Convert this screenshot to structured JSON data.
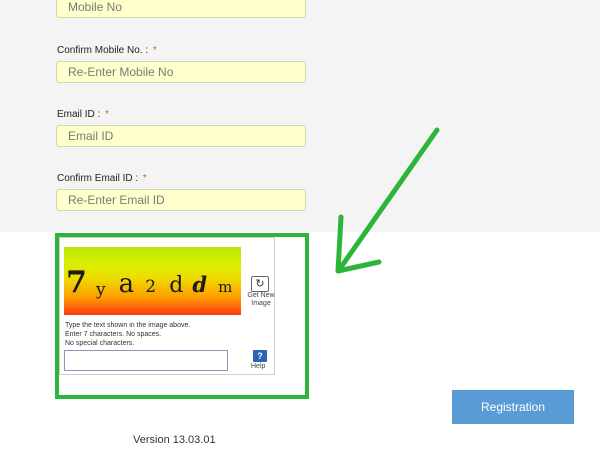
{
  "form": {
    "mobile_placeholder": "Mobile No",
    "confirm_mobile_label": "Confirm Mobile No. :",
    "confirm_mobile_placeholder": "Re-Enter Mobile No",
    "email_label": "Email ID :",
    "email_placeholder": "Email ID",
    "confirm_email_label": "Confirm Email ID :",
    "confirm_email_placeholder": "Re-Enter Email ID",
    "required_marker": "*"
  },
  "captcha": {
    "chars": [
      "7",
      "y",
      "a",
      "2",
      "d",
      "d",
      "m"
    ],
    "refresh_icon": "refresh-icon",
    "get_new_label": "Get New Image",
    "instruction_lines": [
      "Type the text shown in the image above.",
      "Enter 7 characters. No spaces.",
      "No special characters."
    ],
    "help_symbol": "?",
    "help_label": "Help"
  },
  "register_button_label": "Registration",
  "version_text": "Version 13.03.01",
  "colors": {
    "highlight": "#2db53a",
    "button": "#5b9bd5",
    "field_bg": "#ffffcc",
    "required": "#d9534f"
  }
}
